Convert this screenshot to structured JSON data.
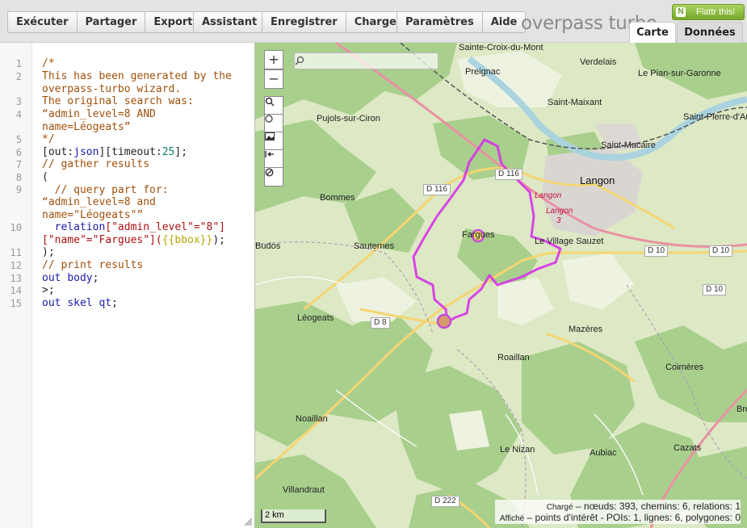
{
  "toolbar": {
    "run": "Exécuter",
    "share": "Partager",
    "export": "Exporter",
    "wizard": "Assistant",
    "save": "Enregistrer",
    "load": "Charger",
    "settings": "Paramètres",
    "help": "Aide"
  },
  "brand": "overpass turbo",
  "flattr": "Flattr this!",
  "tabs": {
    "map": "Carte",
    "data": "Données"
  },
  "editor": {
    "line_numbers": [
      "1",
      "2",
      "3",
      "4",
      "5",
      "6",
      "7",
      "8",
      "9",
      "10",
      "11",
      "12",
      "13",
      "14",
      "15"
    ],
    "lines": {
      "l1": "/*",
      "l2": "This has been generated by the",
      "l2b": "overpass-turbo wizard.",
      "l3": "The original search was:",
      "l4": "“admin_level=8 AND",
      "l4b": "name=Léogeats”",
      "l5": "*/",
      "l6a": "[out:",
      "l6b": "json",
      "l6c": "][timeout:",
      "l6d": "25",
      "l6e": "];",
      "l7": "// gather results",
      "l8": "(",
      "l9": "  // query part for:",
      "l9b": "“admin_level=8 and",
      "l9c": "name=\"Léogeats\"”",
      "l10a": "  relation",
      "l10b": "[\"admin_level\"=\"8\"]",
      "l10c": "[\"name\"=\"Fargues\"](",
      "l10d": "{{bbox}}",
      "l10e": ");",
      "l11": ");",
      "l12": "// print results",
      "l13a": "out ",
      "l13b": "body",
      "l13c": ";",
      "l14": ">;",
      "l15a": "out ",
      "l15b": "skel qt",
      "l15c": ";"
    }
  },
  "map": {
    "zoom_in": "+",
    "zoom_out": "−",
    "scale": "2 km",
    "search_placeholder": "",
    "places": {
      "sainte_croix": "Sainte-Croix-du-Mont",
      "verdelais": "Verdelais",
      "preignac": "Preignac",
      "le_pian": "Le Pian-sur-Garonne",
      "saint_maixant": "Saint-Maixant",
      "pujols": "Pujols-sur-Ciron",
      "saint_pierre": "Saint-Pierre-d'Aur",
      "saint_macaire": "Saint-Macaire",
      "langon": "Langon",
      "langon_red1": "Langon",
      "langon_red2": "Langon",
      "langon_red3": "3",
      "bommes": "Bommes",
      "fargues": "Fargues",
      "budos": "Budos",
      "sauternes": "Sauternes",
      "village_sauzet": "Le Village Sauzet",
      "leogeats": "Léogeats",
      "mazeres": "Mazères",
      "roaillan": "Roaillan",
      "coimeres": "Coimères",
      "noaillan": "Noaillan",
      "le_nizan": "Le Nizan",
      "aubiac": "Aubiac",
      "cazats": "Cazats",
      "villandraut": "Villandraut",
      "bre": "Bre"
    },
    "roads": {
      "d116a": "D 116",
      "d116b": "D 116",
      "d10a": "D 10",
      "d10b": "D 10",
      "d10c": "D 10",
      "d8": "D 8",
      "d222": "D 222"
    },
    "stats": {
      "loaded_label": "Chargé",
      "loaded": " – nœuds: 393, chemins: 6, relations: 1",
      "shown_label": "Affiché",
      "shown": " – points d'intérêt - POIs: 1, lignes: 6, polygones: 0"
    }
  },
  "colors": {
    "highlight": "#d633e8",
    "toolbar": "#e3e3e3"
  }
}
